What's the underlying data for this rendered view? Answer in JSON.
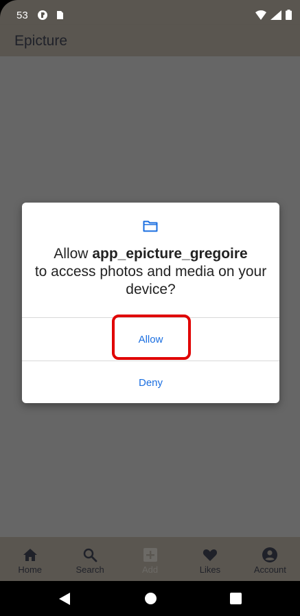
{
  "status_bar": {
    "time": "53",
    "icons": [
      "info-icon",
      "sim-card-icon",
      "wifi-icon",
      "signal-icon",
      "battery-icon"
    ]
  },
  "app_bar": {
    "title": "Epicture"
  },
  "dialog": {
    "icon": "folder-icon",
    "message_prefix": "Allow ",
    "app_name": "app_epicture_gregoire",
    "message_suffix": "to access photos and media on your device?",
    "allow_label": "Allow",
    "deny_label": "Deny"
  },
  "bottom_nav": {
    "items": [
      {
        "label": "Home",
        "icon": "home-icon",
        "enabled": true
      },
      {
        "label": "Search",
        "icon": "search-icon",
        "enabled": true
      },
      {
        "label": "Add",
        "icon": "add-box-icon",
        "enabled": false
      },
      {
        "label": "Likes",
        "icon": "heart-icon",
        "enabled": true
      },
      {
        "label": "Account",
        "icon": "account-circle-icon",
        "enabled": true
      }
    ]
  },
  "system_nav": {
    "buttons": [
      "back-icon",
      "home-circle-icon",
      "recents-icon"
    ]
  },
  "colors": {
    "accent": "#1a6ee0",
    "highlight": "#e00000",
    "bar_bg": "#5a5650",
    "scrim": "#666666"
  }
}
